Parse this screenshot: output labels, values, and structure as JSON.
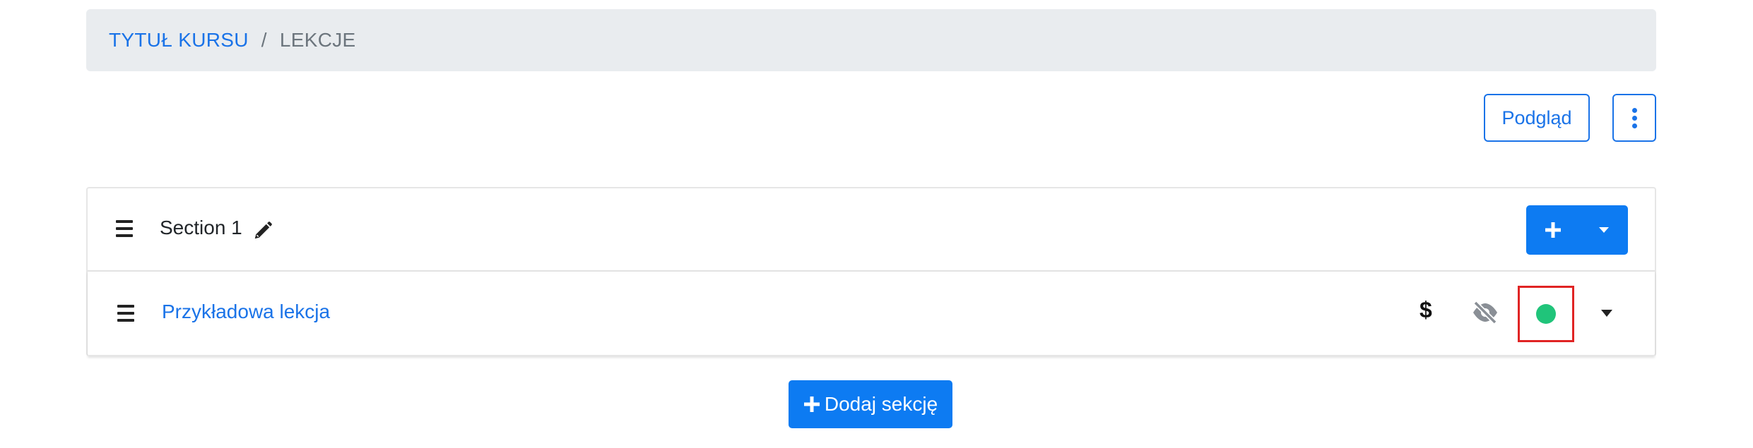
{
  "breadcrumb": {
    "course": "TYTUŁ KURSU",
    "separator": "/",
    "current": "LEKCJE"
  },
  "toolbar": {
    "preview_label": "Podgląd",
    "more_icon": "kebab-vertical-icon"
  },
  "section": {
    "title": "Section 1",
    "edit_icon": "pencil-icon",
    "add_icon": "plus-icon",
    "dropdown_icon": "caret-down-icon",
    "lessons": [
      {
        "title": "Przykładowa lekcja",
        "paid_icon": "$",
        "visibility_icon": "eye-slash-icon",
        "status_icon": "status-dot",
        "status_color": "#20c47a",
        "menu_icon": "caret-down-icon"
      }
    ]
  },
  "add_section": {
    "label": "Dodaj sekcję",
    "icon": "plus-icon"
  },
  "colors": {
    "primary": "#0d7bf2",
    "link": "#1a73e8",
    "status_active": "#20c47a",
    "highlight": "#e02424"
  }
}
